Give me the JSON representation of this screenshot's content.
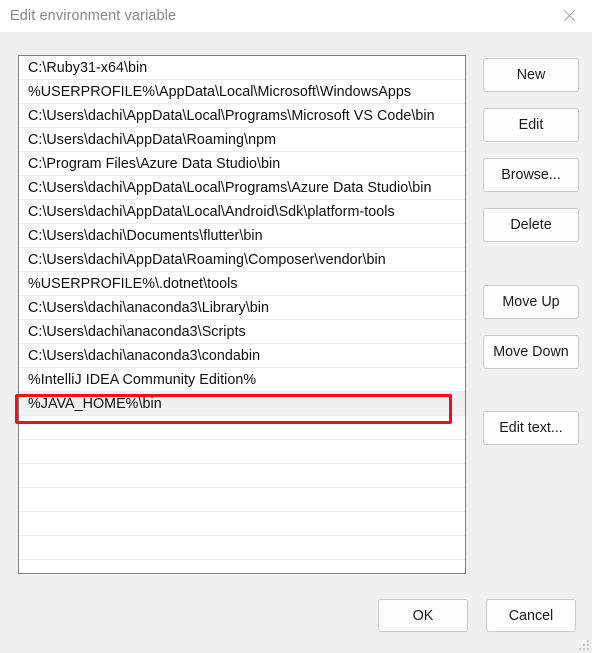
{
  "window": {
    "title": "Edit environment variable",
    "close_icon": "close-icon",
    "resize_grip_icon": "resize-grip-icon"
  },
  "path_list": {
    "items": [
      "C:\\Ruby31-x64\\bin",
      "%USERPROFILE%\\AppData\\Local\\Microsoft\\WindowsApps",
      "C:\\Users\\dachi\\AppData\\Local\\Programs\\Microsoft VS Code\\bin",
      "C:\\Users\\dachi\\AppData\\Roaming\\npm",
      "C:\\Program Files\\Azure Data Studio\\bin",
      "C:\\Users\\dachi\\AppData\\Local\\Programs\\Azure Data Studio\\bin",
      "C:\\Users\\dachi\\AppData\\Local\\Android\\Sdk\\platform-tools",
      "C:\\Users\\dachi\\Documents\\flutter\\bin",
      "C:\\Users\\dachi\\AppData\\Roaming\\Composer\\vendor\\bin",
      "%USERPROFILE%\\.dotnet\\tools",
      "C:\\Users\\dachi\\anaconda3\\Library\\bin",
      "C:\\Users\\dachi\\anaconda3\\Scripts",
      "C:\\Users\\dachi\\anaconda3\\condabin",
      "%IntelliJ IDEA Community Edition%",
      "%JAVA_HOME%\\bin"
    ],
    "selected_index": 14,
    "empty_row_count": 6
  },
  "annotation": {
    "color": "#f41010",
    "target_item": "%JAVA_HOME%\\bin"
  },
  "side_buttons": {
    "new": "New",
    "edit": "Edit",
    "browse": "Browse...",
    "delete": "Delete",
    "move_up": "Move Up",
    "move_down": "Move Down",
    "edit_text": "Edit text..."
  },
  "bottom_buttons": {
    "ok": "OK",
    "cancel": "Cancel"
  }
}
